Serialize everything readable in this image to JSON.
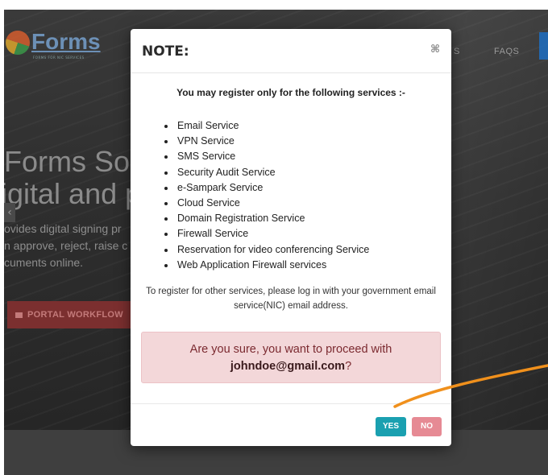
{
  "background": {
    "logo_text": "Forms",
    "logo_sub": "FORMS FOR NIC SERVICES",
    "nav": [
      "S",
      "FAQS"
    ],
    "hero_title_lines": [
      "Forms Sol",
      "igital and p"
    ],
    "hero_body_lines": [
      "ovides digital signing pr",
      "n approve, reject, raise c",
      "cuments online."
    ],
    "workflow_button": "PORTAL WORKFLOW"
  },
  "modal": {
    "title": "NOTE:",
    "intro": "You may register only for the following services :-",
    "services": [
      "Email Service",
      "VPN Service",
      "SMS Service",
      "Security Audit Service",
      "e-Sampark Service",
      "Cloud Service",
      "Domain Registration Service",
      "Firewall Service",
      "Reservation for video conferencing Service",
      "Web Application Firewall services"
    ],
    "note": "To register for other services, please log in with your government email service(NIC) email address.",
    "confirm_prefix": "Are you sure, you want to proceed with",
    "email": "johndoe@gmail.com",
    "confirm_suffix": "?",
    "yes_label": "YES",
    "no_label": "NO"
  },
  "colors": {
    "accent_yes": "#1aa0b0",
    "accent_no": "#e68a94",
    "alert_bg": "#f3d7d9",
    "annotation_arrow": "#f0901c"
  }
}
